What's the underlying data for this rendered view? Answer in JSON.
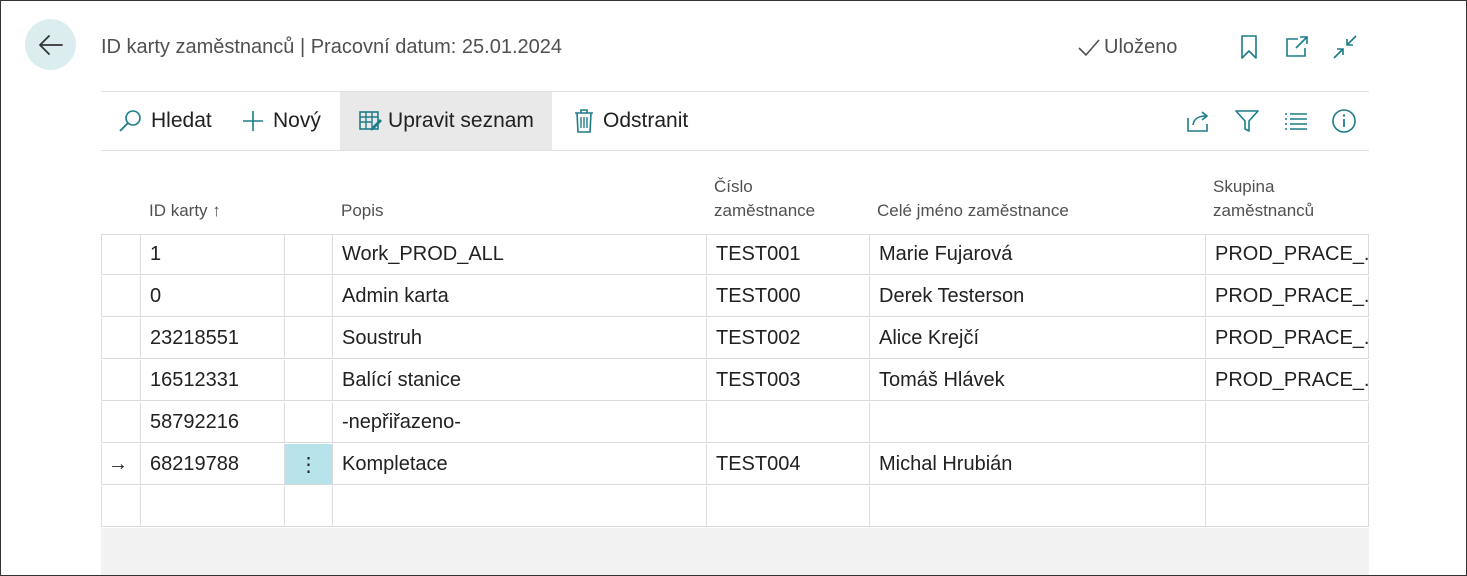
{
  "header": {
    "title": "ID karty zaměstnanců | Pracovní datum: 25.01.2024",
    "saved_label": "Uloženo"
  },
  "toolbar": {
    "search_label": "Hledat",
    "new_label": "Nový",
    "edit_list_label": "Upravit seznam",
    "delete_label": "Odstranit"
  },
  "columns": {
    "card_id": "ID karty",
    "card_id_sort": "↑",
    "description": "Popis",
    "employee_no_1": "Číslo",
    "employee_no_2": "zaměstnance",
    "full_name": "Celé jméno zaměstnance",
    "employee_group_1": "Skupina",
    "employee_group_2": "zaměstnanců"
  },
  "rows": [
    {
      "card_id": "1",
      "description": "Work_PROD_ALL",
      "employee_no": "TEST001",
      "full_name": "Marie Fujarová",
      "employee_group": "PROD_PRACE_..."
    },
    {
      "card_id": "0",
      "description": "Admin karta",
      "employee_no": "TEST000",
      "full_name": "Derek Testerson",
      "employee_group": "PROD_PRACE_..."
    },
    {
      "card_id": "23218551",
      "description": "Soustruh",
      "employee_no": "TEST002",
      "full_name": "Alice Krejčí",
      "employee_group": "PROD_PRACE_..."
    },
    {
      "card_id": "16512331",
      "description": "Balící stanice",
      "employee_no": "TEST003",
      "full_name": "Tomáš Hlávek",
      "employee_group": "PROD_PRACE_..."
    },
    {
      "card_id": "58792216",
      "description": "-nepřiřazeno-",
      "employee_no": "",
      "full_name": "",
      "employee_group": ""
    },
    {
      "card_id": "68219788",
      "description": "Kompletace",
      "employee_no": "TEST004",
      "full_name": "Michal Hrubián",
      "employee_group": "",
      "current": "→",
      "actions": "⋮"
    }
  ],
  "colors": {
    "accent": "#1d7c89",
    "back_button_bg": "#dcedf0",
    "selected_cell_bg": "#b6e4ea"
  }
}
